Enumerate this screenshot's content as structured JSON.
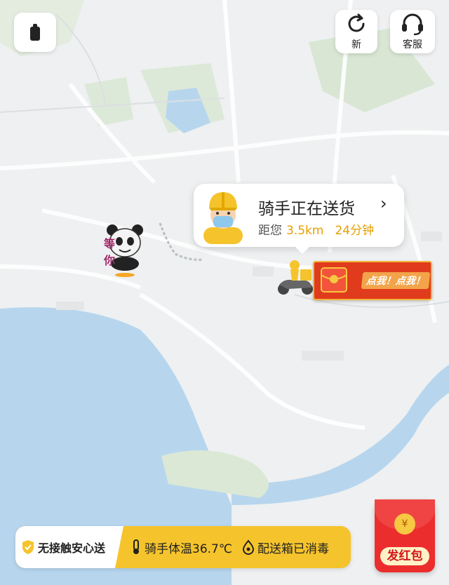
{
  "top_buttons": {
    "refresh_label": "新",
    "service_label": "客服"
  },
  "map": {
    "water_color": "#b7d6ee",
    "land_color": "#eef0f1",
    "green_color": "#d9e7d4",
    "road_color": "#ffffff"
  },
  "rider_status": {
    "title": "骑手正在送货",
    "distance_prefix": "距您",
    "distance_value": "3.5km",
    "eta": "24分钟"
  },
  "promo": {
    "text": "点我！点我！"
  },
  "sticker": {
    "text_top": "等",
    "text_bottom": "你"
  },
  "safety_bar": {
    "badge_label": "无接触安心送",
    "temperature_label": "骑手体温36.7℃",
    "disinfect_label": "配送箱已消毒"
  },
  "red_packet_button": {
    "label": "发红包",
    "coin_symbol": "¥"
  },
  "colors": {
    "accent_yellow": "#f5c42c",
    "highlight_orange": "#e5a000",
    "red": "#ec2d2d"
  }
}
